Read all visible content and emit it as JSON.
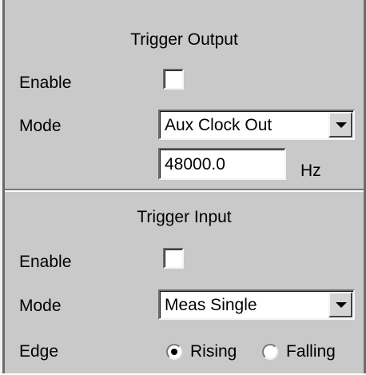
{
  "trigger_output": {
    "title": "Trigger Output",
    "enable_label": "Enable",
    "enable_checked": false,
    "mode_label": "Mode",
    "mode_value": "Aux Clock Out",
    "frequency_value": "48000.0",
    "frequency_unit": "Hz"
  },
  "trigger_input": {
    "title": "Trigger Input",
    "enable_label": "Enable",
    "enable_checked": false,
    "mode_label": "Mode",
    "mode_value": "Meas Single",
    "edge_label": "Edge",
    "edge_options": [
      "Rising",
      "Falling"
    ],
    "edge_selected": "Rising"
  },
  "icons": {
    "dropdown": "chevron-down-icon",
    "radio": "radio-icon"
  }
}
